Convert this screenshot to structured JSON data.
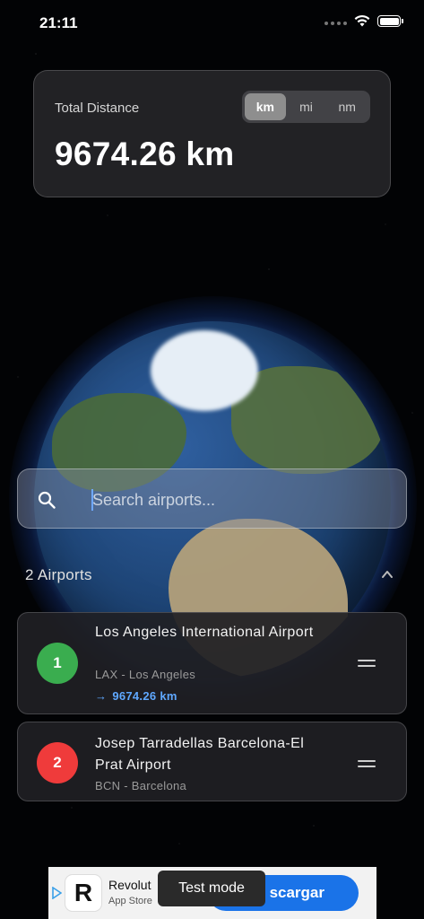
{
  "status_bar": {
    "time": "21:11"
  },
  "distance_card": {
    "label": "Total Distance",
    "value": "9674.26 km",
    "units": [
      "km",
      "mi",
      "nm"
    ],
    "selected_unit": "km"
  },
  "search": {
    "placeholder": "Search airports..."
  },
  "list_header": {
    "count_label": "2 Airports"
  },
  "airports": [
    {
      "index": "1",
      "name": "Los Angeles International Airport",
      "code_city": "LAX - Los Angeles",
      "distance_arrow": "→",
      "distance": "9674.26 km",
      "color": "#3aad4f"
    },
    {
      "index": "2",
      "name": "Josep Tarradellas Barcelona-El Prat Airport",
      "code_city": "BCN - Barcelona",
      "color": "#ef3b3b"
    }
  ],
  "ad": {
    "logo_letter": "R",
    "app_name": "Revolut",
    "store": "App Store",
    "cta": "scargar",
    "test_mode": "Test mode"
  }
}
